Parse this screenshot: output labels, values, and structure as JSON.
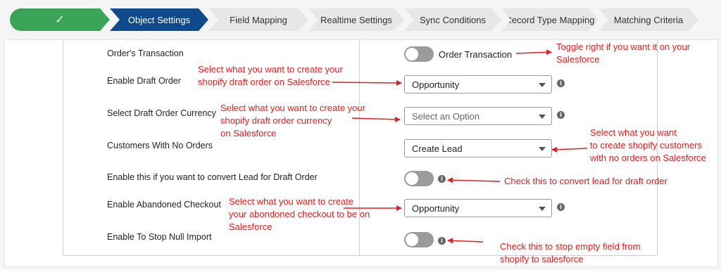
{
  "stepper": {
    "steps": [
      {
        "label": "",
        "state": "done",
        "icon": "check-icon"
      },
      {
        "label": "Object Settings",
        "state": "active"
      },
      {
        "label": "Field Mapping",
        "state": "todo"
      },
      {
        "label": "Realtime Settings",
        "state": "todo"
      },
      {
        "label": "Sync Conditions",
        "state": "todo"
      },
      {
        "label": "Record Type Mapping",
        "state": "todo"
      },
      {
        "label": "Matching Criteria",
        "state": "todo"
      }
    ]
  },
  "form": {
    "rows": [
      {
        "label": "Order's Transaction",
        "control": "toggle",
        "toggle_text": "Order Transaction"
      },
      {
        "label": "Enable Draft Order",
        "control": "select",
        "value": "Opportunity"
      },
      {
        "label": "Select Draft Order Currency",
        "control": "select",
        "value": "Select an Option"
      },
      {
        "label": "Customers With No Orders",
        "control": "select",
        "value": "Create Lead"
      },
      {
        "label": "Enable this if you want to convert Lead for Draft Order",
        "control": "toggle"
      },
      {
        "label": "Enable Abandoned Checkout",
        "control": "select",
        "value": "Opportunity"
      },
      {
        "label": "Enable To Stop Null Import",
        "control": "toggle"
      }
    ]
  },
  "annotations": {
    "toggle_order": [
      "Toggle right if you want it on your",
      "Salesforce"
    ],
    "draft_order": [
      "Select what you want to create your",
      "shopify draft order on Salesforce"
    ],
    "draft_currency": [
      "Select what you want to create your",
      "shopify draft order currency",
      "on Salesforce"
    ],
    "customers": [
      "Select what you want",
      "to create shopify customers",
      "with no orders on Salesforce"
    ],
    "convert_lead": [
      "Check this to convert lead for draft order"
    ],
    "abandoned": [
      "Select what you want to create",
      "your abondoned checkout to be on",
      "Salesforce"
    ],
    "stop_null": [
      "Check this to stop empty field from",
      "shopify to salesforce"
    ]
  },
  "colors": {
    "done": "#3aa558",
    "active": "#0f4a8c",
    "step_gray": "#e7e7e7",
    "annotation": "#e02020",
    "toggle_off": "#9b9b9b"
  }
}
